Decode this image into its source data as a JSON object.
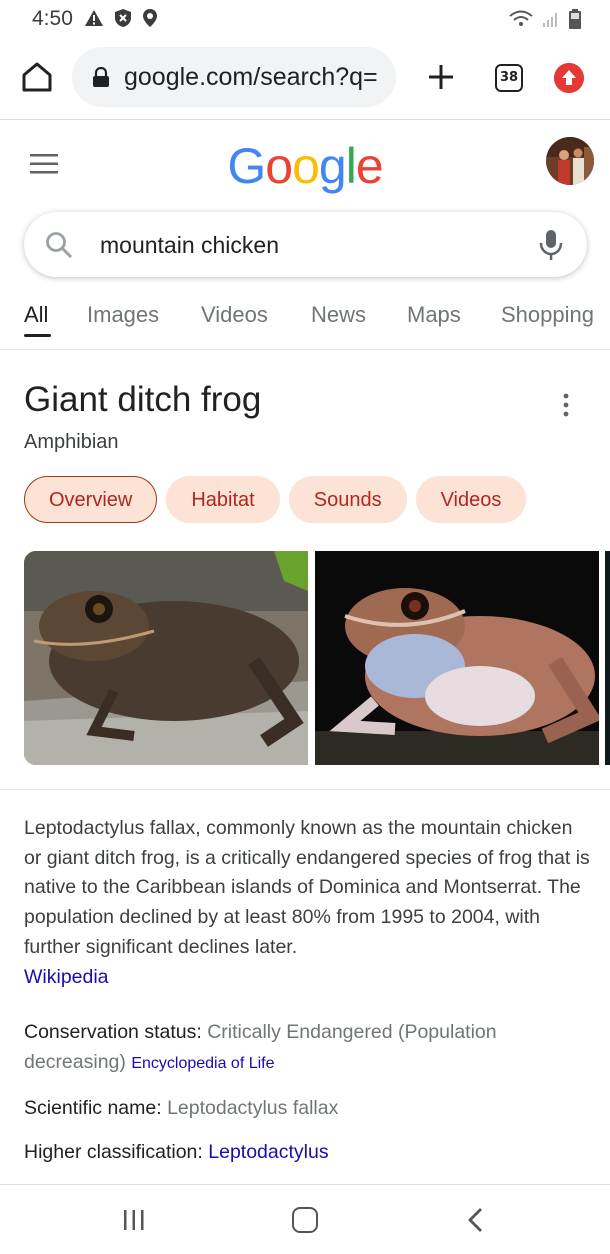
{
  "status_bar": {
    "time": "4:50",
    "left_icons": [
      "warning-icon",
      "shield-icon",
      "location-icon"
    ],
    "right_icons": [
      "wifi-icon",
      "signal-icon",
      "battery-icon"
    ]
  },
  "browser": {
    "url": "google.com/search?q=",
    "tab_count": "38",
    "icons": [
      "home-icon",
      "lock-icon",
      "new-tab-icon",
      "tab-switcher-icon",
      "update-icon"
    ]
  },
  "google": {
    "logo": "Google",
    "logo_colors": [
      "#4285F4",
      "#EA4335",
      "#FBBC05",
      "#4285F4",
      "#34A853",
      "#EA4335"
    ]
  },
  "search": {
    "query": "mountain chicken"
  },
  "tabs": [
    {
      "label": "All",
      "active": true
    },
    {
      "label": "Images",
      "active": false
    },
    {
      "label": "Videos",
      "active": false
    },
    {
      "label": "News",
      "active": false
    },
    {
      "label": "Maps",
      "active": false
    },
    {
      "label": "Shopping",
      "active": false
    }
  ],
  "panel": {
    "title": "Giant ditch frog",
    "subtitle": "Amphibian",
    "chips": [
      {
        "label": "Overview",
        "selected": true
      },
      {
        "label": "Habitat",
        "selected": false
      },
      {
        "label": "Sounds",
        "selected": false
      },
      {
        "label": "Videos",
        "selected": false
      }
    ],
    "description": "Leptodactylus fallax, commonly known as the mountain chicken or giant ditch frog, is a critically endangered species of frog that is native to the Caribbean islands of Dominica and Montserrat. The population declined by at least 80% from 1995 to 2004, with further significant declines later.",
    "description_source": "Wikipedia",
    "facts": [
      {
        "label": "Conservation status: ",
        "value": "Critically Endangered (Population decreasing)",
        "source": "Encyclopedia of Life"
      },
      {
        "label": "Scientific name: ",
        "value": "Leptodactylus fallax"
      },
      {
        "label": "Higher classification: ",
        "value": "Leptodactylus"
      }
    ]
  },
  "colors": {
    "chip_bg": "#fde3d6",
    "chip_text": "#b3261e",
    "link": "#1a0dab"
  },
  "nav": {
    "icons": [
      "recent-apps-icon",
      "home-button-icon",
      "back-icon"
    ]
  }
}
